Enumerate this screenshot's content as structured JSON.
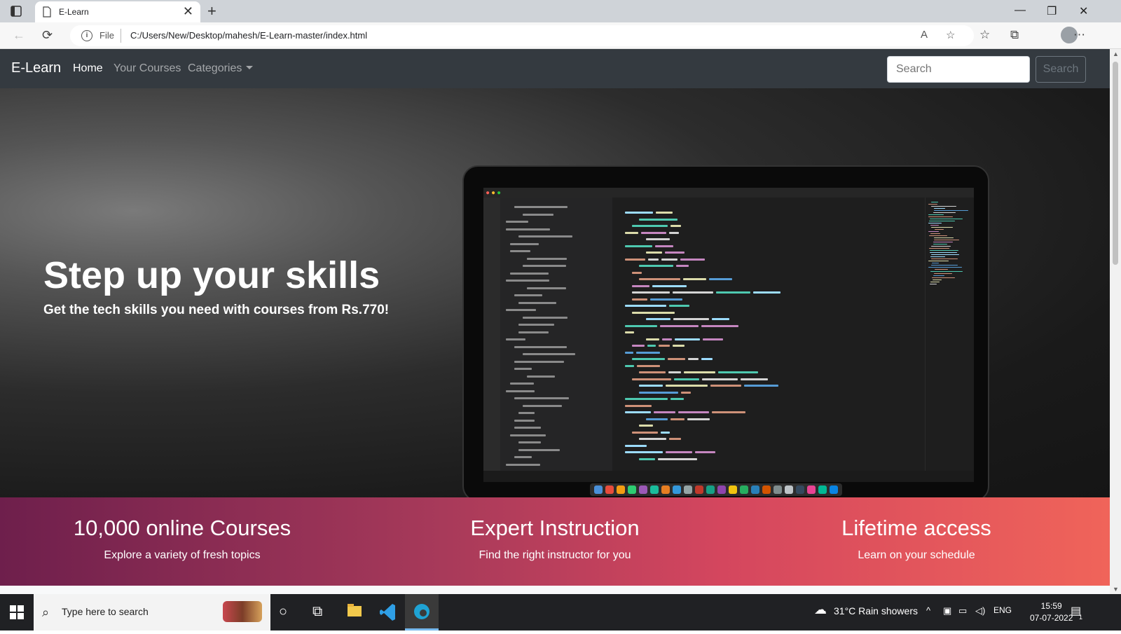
{
  "browser": {
    "tab_title": "E-Learn",
    "tab_close": "✕",
    "new_tab": "+",
    "scheme_label": "File",
    "url": "C:/Users/New/Desktop/mahesh/E-Learn-master/index.html",
    "window_controls": [
      "—",
      "❐",
      "✕"
    ]
  },
  "nav": {
    "brand": "E-Learn",
    "links": [
      "Home",
      "Your Courses",
      "Categories"
    ],
    "search_placeholder": "Search",
    "search_button": "Search"
  },
  "hero": {
    "title": "Step up your skills",
    "subtitle": "Get the tech skills you need with courses from Rs.770!"
  },
  "features": [
    {
      "title": "10,000 online Courses",
      "text": "Explore a variety of fresh topics"
    },
    {
      "title": "Expert Instruction",
      "text": "Find the right instructor for you"
    },
    {
      "title": "Lifetime access",
      "text": "Learn on your schedule"
    }
  ],
  "taskbar": {
    "search_text": "Type here to search",
    "weather": "31°C  Rain showers",
    "language": "ENG",
    "time": "15:59",
    "date": "07-07-2022",
    "notification_count": "1"
  },
  "colors": {
    "navbar": "#343a40",
    "features_start": "#6e1f4c",
    "features_end": "#f0645a"
  }
}
